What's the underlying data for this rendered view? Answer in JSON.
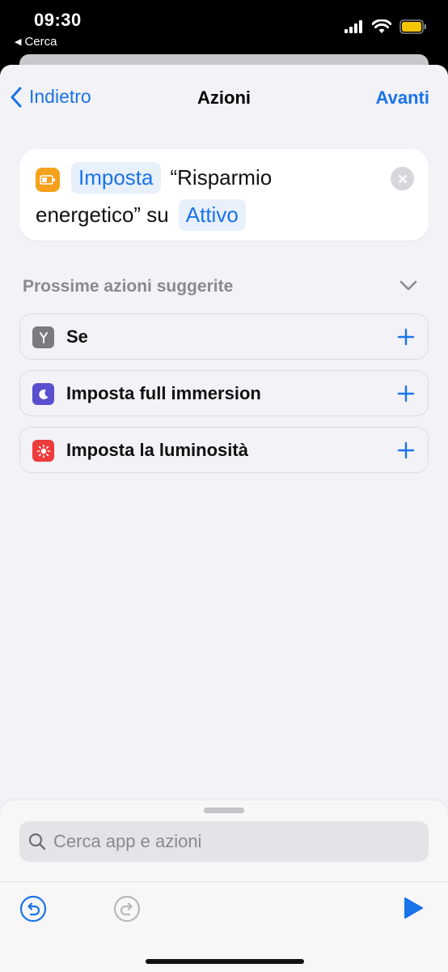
{
  "status_bar": {
    "time": "09:30",
    "back_app": "Cerca",
    "icons": [
      "cellular-signal-icon",
      "wifi-icon",
      "battery-icon"
    ],
    "battery_color": "#f5c400"
  },
  "nav": {
    "back_label": "Indietro",
    "title": "Azioni",
    "next_label": "Avanti"
  },
  "action": {
    "app_icon": "battery-app-icon",
    "verb_token": "Imposta",
    "text_part1": "“Risparmio",
    "text_part2": "energetico” su",
    "value_token": "Attivo",
    "remove_icon": "close-icon"
  },
  "suggestions": {
    "header": "Prossime azioni suggerite",
    "items": [
      {
        "label": "Se",
        "icon": "branch-icon",
        "icon_color": "#7a7a80"
      },
      {
        "label": "Imposta full immersion",
        "icon": "moon-icon",
        "icon_color": "#5a4fcf"
      },
      {
        "label": "Imposta la luminosità",
        "icon": "sun-icon",
        "icon_color": "#ee3b3b"
      }
    ]
  },
  "bottom_sheet": {
    "search_placeholder": "Cerca app e azioni"
  },
  "colors": {
    "accent": "#1a73e8",
    "background": "#f2f2f7",
    "card": "#ffffff"
  }
}
